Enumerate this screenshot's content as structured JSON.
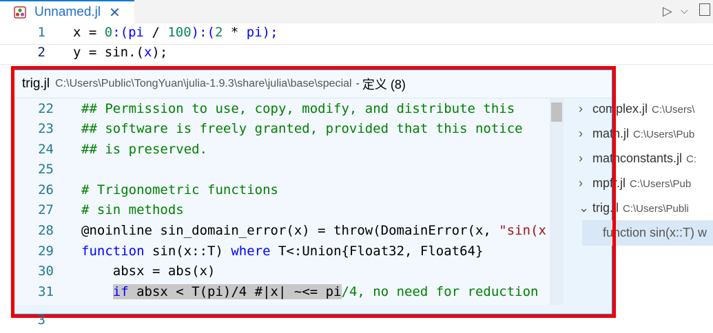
{
  "tab": {
    "title": "Unnamed.jl",
    "close": "✕"
  },
  "toolbar": {
    "run_icon": "▷",
    "chevron": "⌵"
  },
  "editor": {
    "lines": [
      {
        "n": "1"
      },
      {
        "n": "2"
      },
      {
        "n": "3"
      }
    ],
    "line1": {
      "a": "x = ",
      "b": "0",
      "c": ":(",
      "d": "pi",
      "e": " / ",
      "f": "100",
      "g": "):(",
      "h": "2",
      "i": " * ",
      "j": "pi",
      "k": ");"
    },
    "line2": {
      "a": "y = sin.(",
      "b": "x",
      "c": ");"
    }
  },
  "peek": {
    "file": "trig.jl",
    "path": "C:\\Users\\Public\\TongYuan\\julia-1.9.3\\share\\julia\\base\\special",
    "sep": "-",
    "definition": "定义 (8)",
    "lines": [
      {
        "n": "22",
        "text": "## Permission to use, copy, modify, and distribute this"
      },
      {
        "n": "23",
        "text": "## software is freely granted, provided that this notice"
      },
      {
        "n": "24",
        "text": "## is preserved."
      },
      {
        "n": "25",
        "text": ""
      },
      {
        "n": "26",
        "text": "# Trigonometric functions"
      },
      {
        "n": "27",
        "text": "# sin methods"
      },
      {
        "n": "28",
        "a": "@noinline sin_domain_error(x) = throw(DomainError(x, ",
        "b": "\"sin(x"
      },
      {
        "n": "29",
        "a": "function",
        "b": " sin(x::T) ",
        "c": "where",
        "d": " T<:Union{Float32, Float64}"
      },
      {
        "n": "30",
        "text": "    absx = abs(x)"
      },
      {
        "n": "31",
        "a": "    ",
        "b": "if",
        "c": " absx < T(pi)/4 #|x| ~<= pi",
        "d": "/4, no need for reduction"
      }
    ]
  },
  "references": [
    {
      "name": "complex.jl",
      "path": "C:\\Users\\"
    },
    {
      "name": "math.jl",
      "path": "C:\\Users\\Pub"
    },
    {
      "name": "mathconstants.jl",
      "path": "C:"
    },
    {
      "name": "mpfr.jl",
      "path": "C:\\Users\\Pub"
    },
    {
      "name": "trig.jl",
      "path": "C:\\Users\\Publi"
    }
  ],
  "selected_reference": "function sin(x::T) w"
}
